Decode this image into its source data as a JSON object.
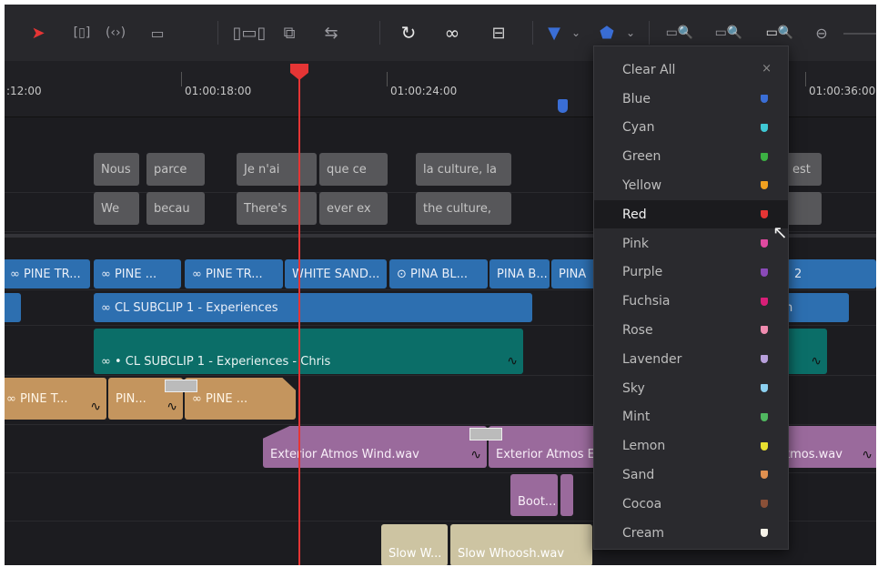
{
  "toolbar": {
    "tools": [
      "pointer-icon",
      "trim-icon",
      "dynamic-trim-icon",
      "blade-icon",
      "insert-icon",
      "overwrite-icon",
      "replace-icon",
      "snapping-icon",
      "link-icon",
      "lock-icon",
      "flag-icon",
      "marker-icon",
      "zoom-full-icon",
      "zoom-detail-icon",
      "zoom-custom-icon",
      "zoom-out-icon"
    ]
  },
  "ruler": {
    "timecodes": [
      ":12:00",
      "01:00:18:00",
      "01:00:24:00",
      "01:00:36:00"
    ]
  },
  "subtitles": {
    "row1": [
      "Nous",
      "parce",
      "Je n'ai",
      "que ce",
      "la culture, la",
      "est"
    ],
    "row2": [
      "We",
      "becau",
      "There's",
      "ever ex",
      "the culture,"
    ]
  },
  "video_track_1": [
    "PINE TR...",
    "PINE ...",
    "PINE TR...",
    "WHITE SAND...",
    "PINA BL...",
    "PINA B...",
    "PINA",
    "2"
  ],
  "video_track_2": [
    "CL SUBCLIP 1 - Experiences",
    "n"
  ],
  "video_track_3": [
    "• CL SUBCLIP 1 - Experiences - Chris"
  ],
  "audio_track_1": [
    "PINE T...",
    "PIN...",
    "PINE ..."
  ],
  "audio_track_2": [
    "Exterior Atmos Wind.wav",
    "Exterior Atmos E",
    "tmos.wav"
  ],
  "audio_track_3": [
    "Boot..."
  ],
  "audio_track_4": [
    "Slow W...",
    "Slow Whoosh.wav"
  ],
  "dropdown": {
    "clear_all": "Clear All",
    "close": "×",
    "selected": "Red",
    "items": [
      {
        "label": "Blue",
        "color": "#3a6ed6"
      },
      {
        "label": "Cyan",
        "color": "#3fc8d4"
      },
      {
        "label": "Green",
        "color": "#3cb043"
      },
      {
        "label": "Yellow",
        "color": "#f0a020"
      },
      {
        "label": "Red",
        "color": "#e53535"
      },
      {
        "label": "Pink",
        "color": "#e04aa0"
      },
      {
        "label": "Purple",
        "color": "#8a4ab8"
      },
      {
        "label": "Fuchsia",
        "color": "#d81f78"
      },
      {
        "label": "Rose",
        "color": "#f08cb0"
      },
      {
        "label": "Lavender",
        "color": "#b8a0dc"
      },
      {
        "label": "Sky",
        "color": "#8cd0f0"
      },
      {
        "label": "Mint",
        "color": "#50b860"
      },
      {
        "label": "Lemon",
        "color": "#e8e030"
      },
      {
        "label": "Sand",
        "color": "#e09050"
      },
      {
        "label": "Cocoa",
        "color": "#8a5038"
      },
      {
        "label": "Cream",
        "color": "#f6f2e8"
      }
    ]
  },
  "colors": {
    "playhead": "#e53535",
    "video_clip": "#2d6fb0",
    "teal_clip": "#0b6e68",
    "tan_clip": "#c4955e",
    "purple_clip": "#9a6a9c"
  }
}
